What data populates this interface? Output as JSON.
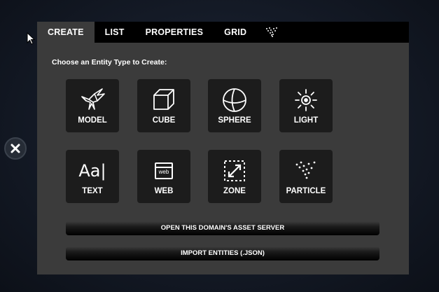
{
  "tabs": [
    {
      "label": "CREATE",
      "active": true
    },
    {
      "label": "LIST"
    },
    {
      "label": "PROPERTIES"
    },
    {
      "label": "GRID"
    }
  ],
  "tab_icon": "particle-icon",
  "heading": "Choose an Entity Type to Create:",
  "entity_types": [
    {
      "label": "MODEL",
      "icon": "bird-model-icon"
    },
    {
      "label": "CUBE",
      "icon": "cube-icon"
    },
    {
      "label": "SPHERE",
      "icon": "sphere-icon"
    },
    {
      "label": "LIGHT",
      "icon": "light-icon"
    },
    {
      "label": "TEXT",
      "icon": "text-icon",
      "icon_text": "Aa|"
    },
    {
      "label": "WEB",
      "icon": "web-icon",
      "icon_text": "web"
    },
    {
      "label": "ZONE",
      "icon": "zone-icon"
    },
    {
      "label": "PARTICLE",
      "icon": "particle-icon"
    }
  ],
  "buttons": {
    "asset_server": "OPEN THIS DOMAIN'S ASSET SERVER",
    "import": "IMPORT ENTITIES (.JSON)"
  },
  "colors": {
    "panel": "#3b3b3b",
    "tile": "#1c1c1c",
    "tabbar": "#000000",
    "text": "#ffffff"
  }
}
